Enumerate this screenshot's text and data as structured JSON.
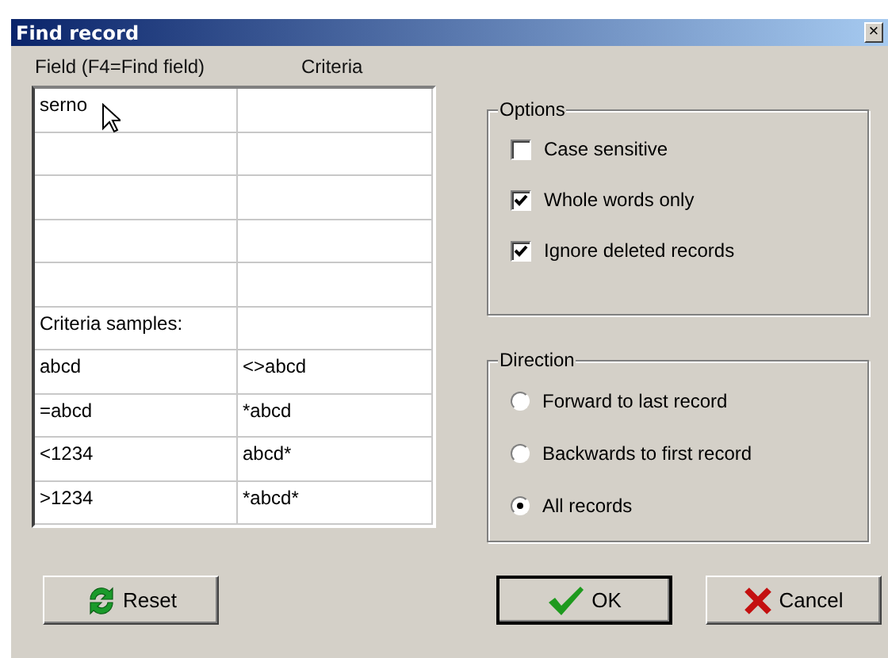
{
  "window": {
    "title": "Find record",
    "close": "×"
  },
  "grid": {
    "columns": [
      "Field  (F4=Find field)",
      "Criteria"
    ],
    "rows": [
      {
        "field": "serno"
      },
      {},
      {},
      {},
      {},
      {
        "field": "Criteria samples:"
      },
      {
        "field": "abcd",
        "criteria": "<>abcd"
      },
      {
        "field": "=abcd",
        "criteria": "*abcd"
      },
      {
        "field": "<1234",
        "criteria": "abcd*"
      },
      {
        "field": ">1234",
        "criteria": "*abcd*"
      }
    ]
  },
  "options": {
    "title": "Options",
    "items": [
      {
        "label": "Case sensitive",
        "checked": false
      },
      {
        "label": "Whole words only",
        "checked": true
      },
      {
        "label": "Ignore deleted records",
        "checked": true
      }
    ]
  },
  "direction": {
    "title": "Direction",
    "items": [
      {
        "label": "Forward to last record",
        "selected": false
      },
      {
        "label": "Backwards to first record",
        "selected": false
      },
      {
        "label": "All records",
        "selected": true
      }
    ]
  },
  "buttons": [
    {
      "kind": "reset",
      "label": "Reset"
    },
    {
      "kind": "ok",
      "label": "OK"
    },
    {
      "kind": "cancel",
      "label": "Cancel"
    }
  ]
}
